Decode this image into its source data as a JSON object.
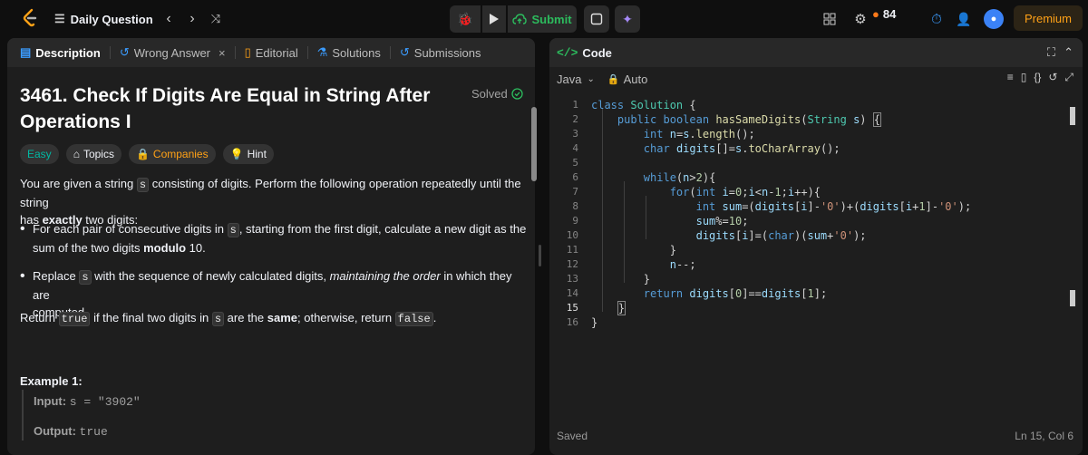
{
  "topbar": {
    "title": "Daily Question",
    "submit_label": "Submit",
    "streak_count": "84",
    "premium_label": "Premium"
  },
  "left_tabs": [
    {
      "label": "Description"
    },
    {
      "label": "Wrong Answer"
    },
    {
      "label": "Editorial"
    },
    {
      "label": "Solutions"
    },
    {
      "label": "Submissions"
    }
  ],
  "problem": {
    "title_line1": "3461. Check If Digits Are Equal in String After",
    "title_line2": "Operations I",
    "solved_label": "Solved",
    "chips": {
      "easy": "Easy",
      "topics": "Topics",
      "companies": "Companies",
      "hint": "Hint"
    },
    "desc1_a": "You are given a string ",
    "desc1_code": "s",
    "desc1_b": " consisting of digits. Perform the following operation repeatedly until the string",
    "desc1_c": "has ",
    "desc1_bold": "exactly",
    "desc1_d": " two digits:",
    "bullet1_a": "For each pair of consecutive digits in ",
    "bullet1_code": "s",
    "bullet1_b": ", starting from the first digit, calculate a new digit as the",
    "bullet1_c": "sum of the two digits ",
    "bullet1_bold": "modulo",
    "bullet1_d": " 10.",
    "bullet2_a": "Replace ",
    "bullet2_code": "s",
    "bullet2_b": " with the sequence of newly calculated digits, ",
    "bullet2_italic": "maintaining the order",
    "bullet2_c": " in which they are",
    "bullet2_d": "computed.",
    "ret_a": "Return ",
    "ret_code1": "true",
    "ret_b": " if the final two digits in ",
    "ret_code2": "s",
    "ret_c": " are the ",
    "ret_bold": "same",
    "ret_d": "; otherwise, return ",
    "ret_code3": "false",
    "ret_e": ".",
    "example_title": "Example 1:",
    "input_label": "Input:",
    "input_value": "s = \"3902\"",
    "output_label": "Output:",
    "output_value": "true"
  },
  "editor": {
    "tab_label": "Code",
    "language": "Java",
    "mode": "Auto",
    "saved_label": "Saved",
    "cursor_pos": "Ln 15, Col 6",
    "line_numbers": [
      "1",
      "2",
      "3",
      "4",
      "5",
      "6",
      "7",
      "8",
      "9",
      "10",
      "11",
      "12",
      "13",
      "14",
      "15",
      "16"
    ]
  }
}
